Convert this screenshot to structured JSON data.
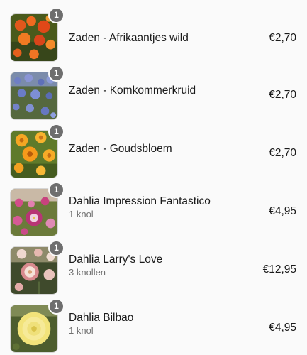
{
  "cart": {
    "items": [
      {
        "title": "Zaden - Afrikaantjes wild",
        "subtitle": "",
        "price": "€2,70",
        "quantity": "1",
        "image_icon": "orange-marigold-flowers"
      },
      {
        "title": "Zaden - Komkommerkruid",
        "subtitle": "",
        "price": "€2,70",
        "quantity": "1",
        "image_icon": "blue-borage-flowers"
      },
      {
        "title": "Zaden - Goudsbloem",
        "subtitle": "",
        "price": "€2,70",
        "quantity": "1",
        "image_icon": "orange-calendula-flowers"
      },
      {
        "title": "Dahlia Impression Fantastico",
        "subtitle": "1 knol",
        "price": "€4,95",
        "quantity": "1",
        "image_icon": "pink-white-dahlia-flowers"
      },
      {
        "title": "Dahlia Larry's Love",
        "subtitle": "3 knollen",
        "price": "€12,95",
        "quantity": "1",
        "image_icon": "pink-cream-dahlia-flowers"
      },
      {
        "title": "Dahlia Bilbao",
        "subtitle": "1 knol",
        "price": "€4,95",
        "quantity": "1",
        "image_icon": "yellow-dahlia-flower"
      }
    ]
  },
  "colors": {
    "background": "#fafafa",
    "badge": "#6e6e6e",
    "subtitle": "#707070"
  }
}
